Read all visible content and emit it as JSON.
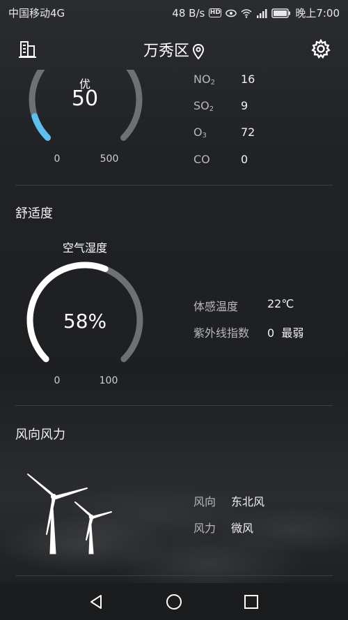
{
  "status_bar": {
    "carrier": "中国移动4G",
    "speed": "48 B/s",
    "hd_badge": "HD",
    "signal_text": "4G",
    "time": "晚上7:00"
  },
  "header": {
    "title": "万秀区",
    "icons": [
      "city-icon",
      "location-pin-icon",
      "gear-icon"
    ]
  },
  "aqi": {
    "level": "优",
    "value": "50",
    "scale_min": "0",
    "scale_max": "500",
    "progress_fraction": 0.1,
    "accent_color": "#5bc0f0",
    "pollutants": [
      {
        "name": "NO",
        "sub": "2",
        "value": "16"
      },
      {
        "name": "SO",
        "sub": "2",
        "value": "9"
      },
      {
        "name": "O",
        "sub": "3",
        "value": "72"
      },
      {
        "name": "CO",
        "sub": "",
        "value": "0"
      }
    ]
  },
  "comfort": {
    "title": "舒适度",
    "humidity_label": "空气湿度",
    "humidity_value": "58%",
    "humidity_fraction": 0.58,
    "scale_min": "0",
    "scale_max": "100",
    "feels_like_label": "体感温度",
    "feels_like_value": "22℃",
    "uv_label": "紫外线指数",
    "uv_value": "0  最弱"
  },
  "wind": {
    "title": "风向风力",
    "direction_label": "风向",
    "direction_value": "东北风",
    "force_label": "风力",
    "force_value": "微风"
  },
  "navbar": {
    "icons": [
      "back-icon",
      "home-icon",
      "recents-icon"
    ]
  }
}
